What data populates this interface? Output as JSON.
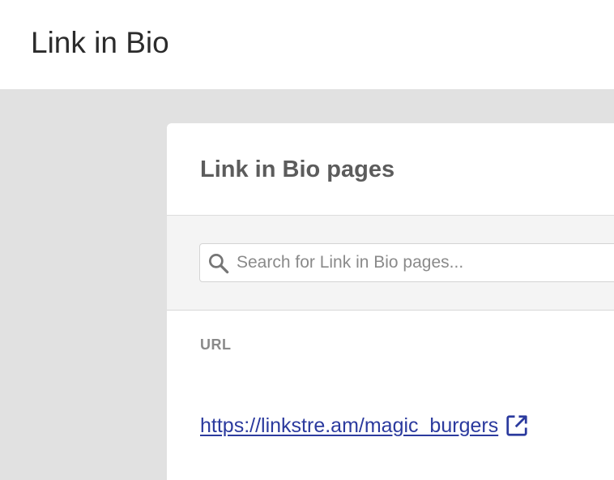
{
  "header": {
    "title": "Link in Bio"
  },
  "card": {
    "title": "Link in Bio pages",
    "search": {
      "placeholder": "Search for Link in Bio pages...",
      "value": ""
    },
    "columns": [
      "URL"
    ],
    "rows": [
      {
        "url": "https://linkstre.am/magic_burgers"
      }
    ]
  },
  "icons": {
    "search": "search-icon",
    "external": "external-link-icon"
  },
  "colors": {
    "link": "#2b3a9e",
    "background": "#e1e1e1",
    "search_area": "#f4f4f4"
  }
}
